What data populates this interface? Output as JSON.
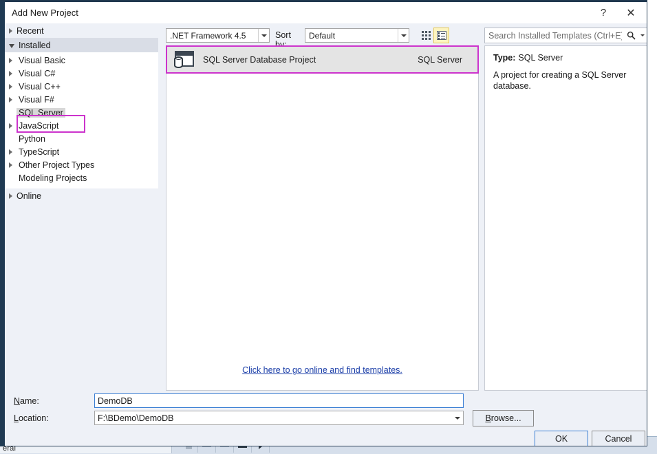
{
  "background_app": {
    "status_text": "eral"
  },
  "dialog": {
    "title": "Add New Project",
    "help_button": "?",
    "close_button": "✕"
  },
  "sidebar": {
    "groups": [
      {
        "label": "Recent",
        "expandable": true,
        "expanded": false,
        "selected": false
      },
      {
        "label": "Installed",
        "expandable": true,
        "expanded": true,
        "selected": true
      },
      {
        "label": "Online",
        "expandable": true,
        "expanded": false,
        "selected": false
      }
    ],
    "installed_items": [
      {
        "label": "Visual Basic",
        "expandable": true,
        "selected": false
      },
      {
        "label": "Visual C#",
        "expandable": true,
        "selected": false
      },
      {
        "label": "Visual C++",
        "expandable": true,
        "selected": false
      },
      {
        "label": "Visual F#",
        "expandable": true,
        "selected": false
      },
      {
        "label": "SQL Server",
        "expandable": false,
        "selected": true
      },
      {
        "label": "JavaScript",
        "expandable": true,
        "selected": false
      },
      {
        "label": "Python",
        "expandable": false,
        "selected": false
      },
      {
        "label": "TypeScript",
        "expandable": true,
        "selected": false
      },
      {
        "label": "Other Project Types",
        "expandable": true,
        "selected": false
      },
      {
        "label": "Modeling Projects",
        "expandable": false,
        "selected": false
      }
    ]
  },
  "toolbar": {
    "framework_value": ".NET Framework 4.5",
    "sortby_label": "Sort by:",
    "sortby_value": "Default",
    "view_medium_icon": "grid-view-icon",
    "view_list_icon": "list-view-icon",
    "view_list_selected": true
  },
  "search": {
    "placeholder": "Search Installed Templates (Ctrl+E)",
    "value": "",
    "icon": "search-icon",
    "dropdown_icon": "chevron-down-icon"
  },
  "templates": {
    "items": [
      {
        "name": "SQL Server Database Project",
        "language": "SQL Server",
        "icon": "database-project-icon",
        "selected": true
      }
    ],
    "online_link": "Click here to go online and find templates."
  },
  "description": {
    "type_label": "Type:",
    "type_value": "SQL Server",
    "body": "A project for creating a SQL Server database."
  },
  "form": {
    "name_label_pre": "",
    "name_label_key": "N",
    "name_label_post": "ame:",
    "name_value": "DemoDB",
    "location_label_key": "L",
    "location_label_post": "ocation:",
    "location_value": "F:\\BDemo\\DemoDB",
    "location_dropdown_icon": "chevron-down-icon"
  },
  "buttons": {
    "browse_key": "B",
    "browse_post": "rowse...",
    "ok": "OK",
    "cancel": "Cancel"
  },
  "colors": {
    "annotation": "#cc33cc",
    "dialog_chrome": "#1f3a53",
    "panel_bg": "#eef1f7",
    "focus_border": "#3b7fd4",
    "link": "#1b3ea8",
    "selected_row": "#e4e4e4",
    "view_toggle_active": "#fdf4bf"
  }
}
